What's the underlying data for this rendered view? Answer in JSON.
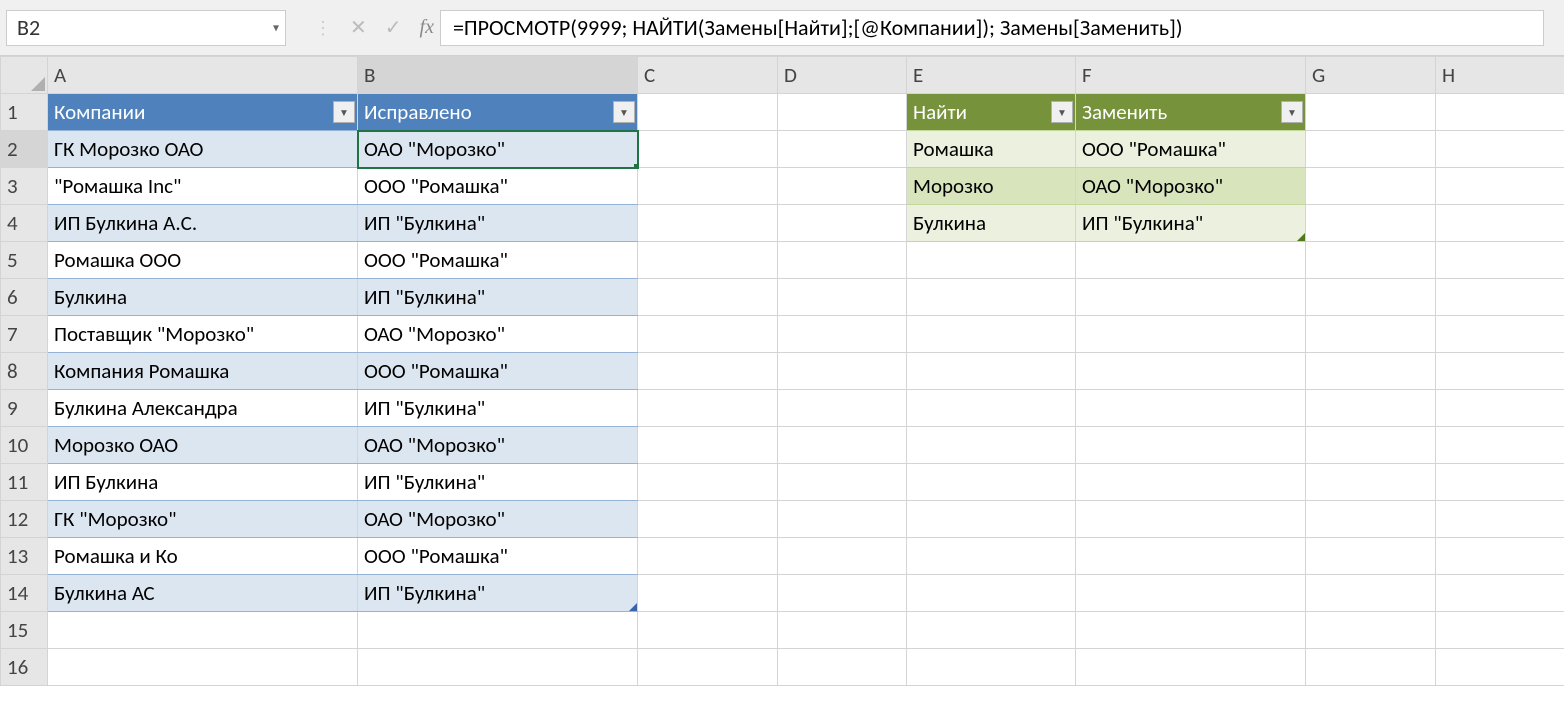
{
  "namebox": {
    "value": "B2"
  },
  "formula": {
    "value": "=ПРОСМОТР(9999; НАЙТИ(Замены[Найти];[@Компании]); Замены[Заменить])"
  },
  "columns": [
    "A",
    "B",
    "C",
    "D",
    "E",
    "F",
    "G",
    "H"
  ],
  "row_numbers": [
    "1",
    "2",
    "3",
    "4",
    "5",
    "6",
    "7",
    "8",
    "9",
    "10",
    "11",
    "12",
    "13",
    "14",
    "15",
    "16"
  ],
  "table1": {
    "headers": {
      "col1": "Компании",
      "col2": "Исправлено"
    },
    "rows": [
      {
        "c1": "ГК Морозко ОАО",
        "c2": "ОАО \"Морозко\""
      },
      {
        "c1": "\"Ромашка Inc\"",
        "c2": "ООО \"Ромашка\""
      },
      {
        "c1": "ИП Булкина А.С.",
        "c2": "ИП \"Булкина\""
      },
      {
        "c1": "Ромашка ООО",
        "c2": "ООО \"Ромашка\""
      },
      {
        "c1": "Булкина",
        "c2": "ИП \"Булкина\""
      },
      {
        "c1": "Поставщик \"Морозко\"",
        "c2": "ОАО \"Морозко\""
      },
      {
        "c1": "Компания Ромашка",
        "c2": "ООО \"Ромашка\""
      },
      {
        "c1": "Булкина Александра",
        "c2": "ИП \"Булкина\""
      },
      {
        "c1": "Морозко ОАО",
        "c2": "ОАО \"Морозко\""
      },
      {
        "c1": "ИП Булкина",
        "c2": "ИП \"Булкина\""
      },
      {
        "c1": "ГК \"Морозко\"",
        "c2": "ОАО \"Морозко\""
      },
      {
        "c1": "Ромашка и Ко",
        "c2": "ООО \"Ромашка\""
      },
      {
        "c1": "Булкина АС",
        "c2": "ИП \"Булкина\""
      }
    ]
  },
  "table2": {
    "headers": {
      "col1": "Найти",
      "col2": "Заменить"
    },
    "rows": [
      {
        "c1": "Ромашка",
        "c2": "ООО \"Ромашка\""
      },
      {
        "c1": "Морозко",
        "c2": "ОАО \"Морозко\""
      },
      {
        "c1": "Булкина",
        "c2": "ИП \"Булкина\""
      }
    ]
  },
  "active_cell": "B2"
}
